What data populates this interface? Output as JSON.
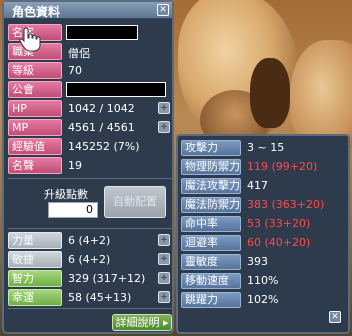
{
  "window": {
    "title": "角色資料",
    "close_icon": "close-icon"
  },
  "profile": [
    {
      "label": "名字",
      "value": "",
      "redacted": true,
      "redact_width": 72
    },
    {
      "label": "職業",
      "value": "僧侶"
    },
    {
      "label": "等級",
      "value": "70"
    },
    {
      "label": "公會",
      "value": "",
      "redacted": true,
      "redact_width": 100
    },
    {
      "label": "HP",
      "value": "1042 / 1042",
      "button": "+"
    },
    {
      "label": "MP",
      "value": "4561 / 4561",
      "button": "+"
    },
    {
      "label": "經驗值",
      "value": "145252 (7%)"
    },
    {
      "label": "名聲",
      "value": "19"
    }
  ],
  "ability_points": {
    "label": "升級點數",
    "value": "0",
    "auto_label": "自動配置"
  },
  "stats": [
    {
      "label": "力量",
      "value": "6 (4+2)",
      "style": "grey"
    },
    {
      "label": "敏捷",
      "value": "6 (4+2)",
      "style": "grey"
    },
    {
      "label": "智力",
      "value": "329 (317+12)",
      "style": "green"
    },
    {
      "label": "幸運",
      "value": "58 (45+13)",
      "style": "green"
    }
  ],
  "detail_button": "詳細說明 ▸",
  "detail": [
    {
      "label": "攻擊力",
      "value": "3 ~ 15",
      "red": false
    },
    {
      "label": "物理防禦力",
      "value": "119 (99+20)",
      "red": true
    },
    {
      "label": "魔法攻擊力",
      "value": "417",
      "red": false
    },
    {
      "label": "魔法防禦力",
      "value": "383 (363+20)",
      "red": true
    },
    {
      "label": "命中率",
      "value": "53 (33+20)",
      "red": true
    },
    {
      "label": "迴避率",
      "value": "60 (40+20)",
      "red": true
    },
    {
      "label": "靈敏度",
      "value": "393",
      "red": false
    },
    {
      "label": "移動速度",
      "value": "110%",
      "red": false
    },
    {
      "label": "跳躍力",
      "value": "102%",
      "red": false
    }
  ],
  "colors": {
    "label_pink": "#c04d75",
    "label_blue": "#56739b",
    "value_red": "#ff4a4a",
    "panel": "#2e3b4c"
  }
}
